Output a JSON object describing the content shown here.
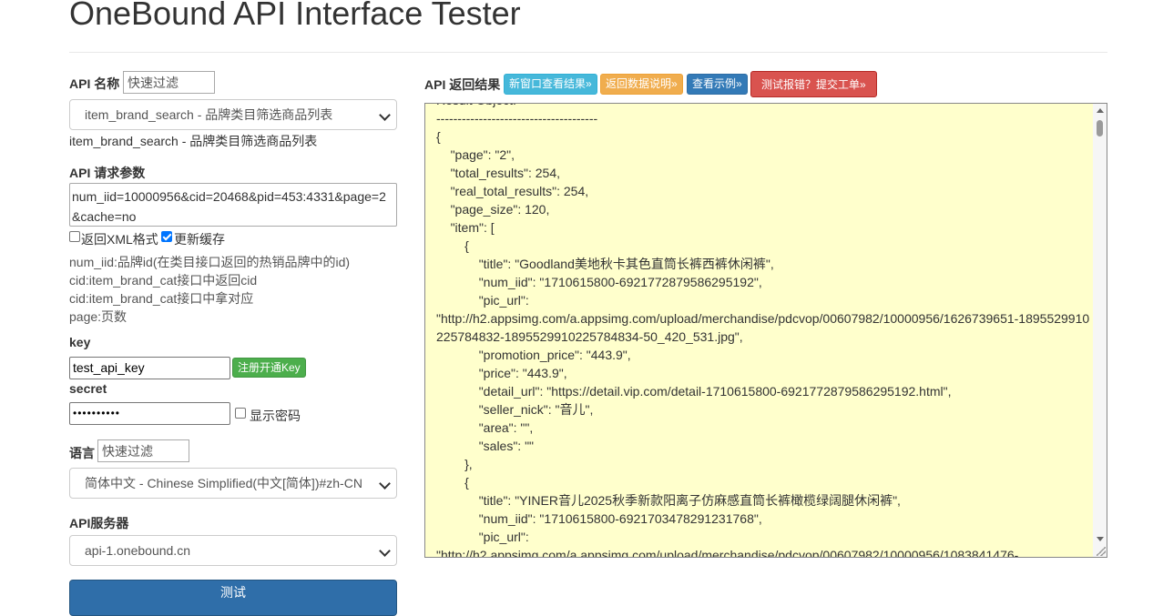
{
  "page": {
    "title": "OneBound API Interface Tester"
  },
  "api_name": {
    "label": "API 名称",
    "filter_placeholder": "快速过滤",
    "selected": "item_brand_search - 品牌类目筛选商品列表",
    "description": "item_brand_search - 品牌类目筛选商品列表"
  },
  "params": {
    "label": "API 请求参数",
    "value": "num_iid=10000956&cid=20468&pid=453:4331&page=2&cache=no",
    "xml_checkbox": {
      "label": "返回XML格式",
      "checked": false
    },
    "cache_checkbox": {
      "label": "更新缓存",
      "checked": true
    },
    "help_lines": [
      "num_iid:品牌id(在类目接口返回的热销品牌中的id)",
      "cid:item_brand_cat接口中返回cid",
      "cid:item_brand_cat接口中拿对应",
      "page:页数"
    ]
  },
  "key": {
    "label": "key",
    "value": "test_api_key",
    "register_button": "注册开通Key"
  },
  "secret": {
    "label": "secret",
    "masked_value": "••••••••••",
    "show_password": {
      "label": "显示密码",
      "checked": false
    }
  },
  "language": {
    "label": "语言",
    "filter_placeholder": "快速过滤",
    "selected": "简体中文 - Chinese Simplified(中文[简体])#zh-CN"
  },
  "server": {
    "label": "API服务器",
    "selected": "api-1.onebound.cn"
  },
  "test_button": "测试",
  "result": {
    "label": "API 返回结果",
    "buttons": {
      "new_window": "新窗口查看结果»",
      "data_doc": "返回数据说明»",
      "example": "查看示例»",
      "report": "测试报错？提交工单»"
    },
    "text": "Result Object:\n--------------------------------------\n{\n\t\"page\": \"2\",\n\t\"total_results\": 254,\n\t\"real_total_results\": 254,\n\t\"page_size\": 120,\n\t\"item\": [\n\t\t{\n\t\t\t\"title\": \"Goodland美地秋卡其色直筒长裤西裤休闲裤\",\n\t\t\t\"num_iid\": \"1710615800-6921772879586295192\",\n\t\t\t\"pic_url\": \n\"http://h2.appsimg.com/a.appsimg.com/upload/merchandise/pdcvop/00607982/10000956/1626739651-1895529910225784832-1895529910225784834-50_420_531.jpg\",\n\t\t\t\"promotion_price\": \"443.9\",\n\t\t\t\"price\": \"443.9\",\n\t\t\t\"detail_url\": \"https://detail.vip.com/detail-1710615800-6921772879586295192.html\",\n\t\t\t\"seller_nick\": \"音儿\",\n\t\t\t\"area\": \"\",\n\t\t\t\"sales\": \"\"\n\t\t},\n\t\t{\n\t\t\t\"title\": \"YINER音儿2025秋季新款阳离子仿麻感直筒长裤橄榄绿阔腿休闲裤\",\n\t\t\t\"num_iid\": \"1710615800-6921703478291231768\",\n\t\t\t\"pic_url\": \n\"http://h2.appsimg.com/a.appsimg.com/upload/merchandise/pdcvop/00607982/10000956/1083841476-"
  }
}
